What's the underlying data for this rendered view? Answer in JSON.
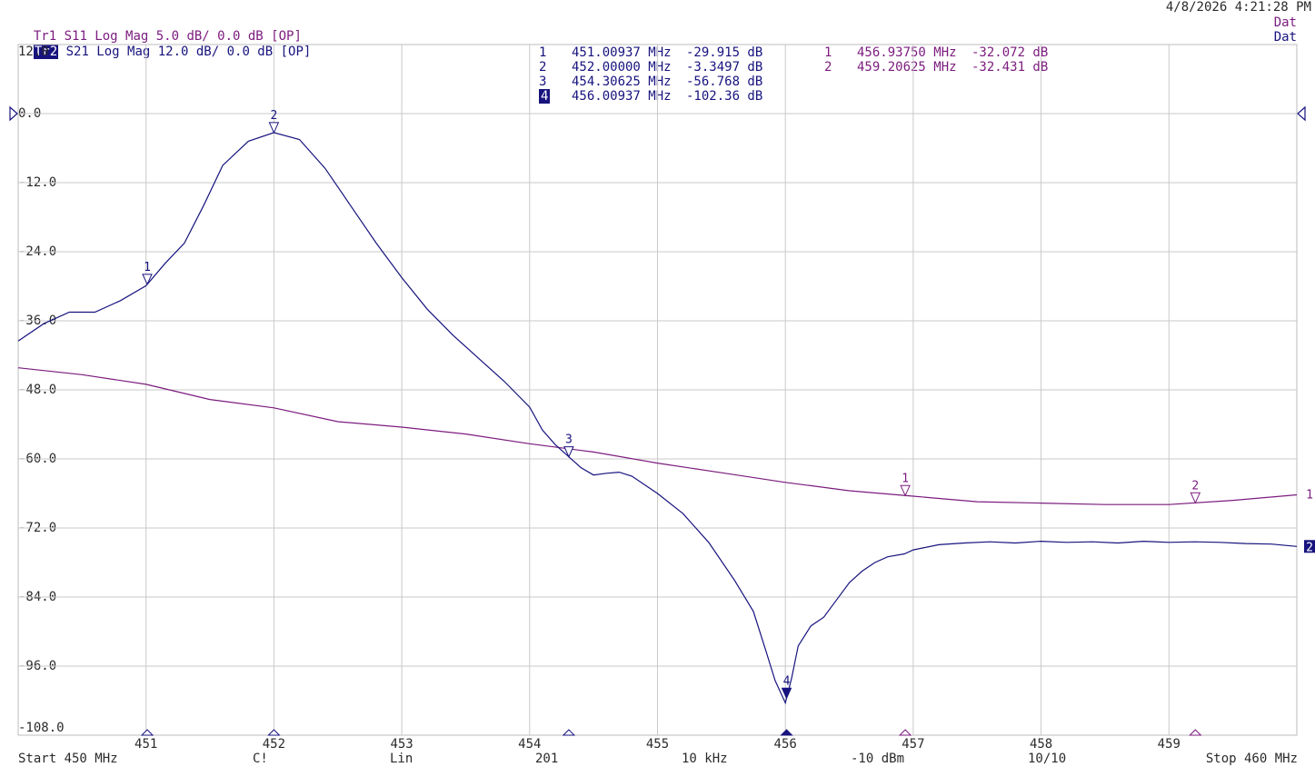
{
  "datetime": "4/8/2026 4:21:28 PM",
  "traces": [
    {
      "id": "Tr1",
      "label": "Tr1",
      "desc": "S11 Log Mag 5.0 dB/ 0.0 dB [OP]",
      "status": "Dat",
      "color": "#7b1b7e"
    },
    {
      "id": "Tr2",
      "label": "Tr2",
      "desc": "S21 Log Mag 12.0 dB/ 0.0 dB [OP]",
      "status": "Dat",
      "color": "#17137e"
    }
  ],
  "markers_tr2": [
    {
      "n": "1",
      "freq": "451.00937 MHz",
      "value": "-29.915 dB",
      "active": false
    },
    {
      "n": "2",
      "freq": "452.00000 MHz",
      "value": "-3.3497 dB",
      "active": false
    },
    {
      "n": "3",
      "freq": "454.30625 MHz",
      "value": "-56.768 dB",
      "active": false
    },
    {
      "n": "4",
      "freq": "456.00937 MHz",
      "value": "-102.36 dB",
      "active": true
    }
  ],
  "markers_tr1": [
    {
      "n": "1",
      "freq": "456.93750 MHz",
      "value": "-32.072 dB"
    },
    {
      "n": "2",
      "freq": "459.20625 MHz",
      "value": "-32.431 dB"
    }
  ],
  "footer": {
    "start": "Start 450 MHz",
    "c": "C!",
    "lin": "Lin",
    "points": "201",
    "ifbw": "10 kHz",
    "power": "-10 dBm",
    "avg": "10/10",
    "stop": "Stop 460 MHz"
  },
  "chart_data": {
    "type": "line",
    "xlabel": "",
    "ylabel": "",
    "xlim": [
      450,
      460
    ],
    "ylim": [
      -108,
      12
    ],
    "y_ticks": [
      "12.0",
      "0.0",
      "-12.0",
      "-24.0",
      "-36.0",
      "-48.0",
      "-60.0",
      "-72.0",
      "-84.0",
      "-96.0",
      "-108.0"
    ],
    "x_ticks": [
      "451",
      "452",
      "453",
      "454",
      "455",
      "456",
      "457",
      "458",
      "459"
    ],
    "reference_level_db": 0.0,
    "grid": true,
    "series": [
      {
        "name": "S21",
        "trace": "Tr2",
        "scale_db_per_div": 12,
        "color": "#17137e",
        "x": [
          450.0,
          450.2,
          450.4,
          450.6,
          450.8,
          451.0,
          451.15,
          451.3,
          451.45,
          451.6,
          451.8,
          452.0,
          452.2,
          452.4,
          452.6,
          452.8,
          453.0,
          453.2,
          453.4,
          453.6,
          453.8,
          454.0,
          454.1,
          454.2,
          454.3,
          454.4,
          454.5,
          454.6,
          454.7,
          454.8,
          455.0,
          455.2,
          455.4,
          455.6,
          455.75,
          455.85,
          455.92,
          456.0,
          456.05,
          456.1,
          456.2,
          456.3,
          456.4,
          456.5,
          456.6,
          456.7,
          456.8,
          456.93,
          457.0,
          457.2,
          457.4,
          457.6,
          457.8,
          458.0,
          458.2,
          458.4,
          458.6,
          458.8,
          459.0,
          459.2,
          459.4,
          459.6,
          459.8,
          460.0
        ],
        "values": [
          -39.5,
          -36.5,
          -34.5,
          -34.5,
          -32.5,
          -29.9,
          -26.0,
          -22.5,
          -16.0,
          -9.0,
          -4.8,
          -3.3,
          -4.5,
          -9.5,
          -16.0,
          -22.5,
          -28.5,
          -34.0,
          -38.5,
          -42.5,
          -46.5,
          -51.0,
          -55.0,
          -57.5,
          -59.5,
          -61.5,
          -62.8,
          -62.5,
          -62.3,
          -63.0,
          -66.0,
          -69.5,
          -74.5,
          -81.0,
          -86.5,
          -93.5,
          -98.5,
          -102.4,
          -98.0,
          -92.5,
          -89.0,
          -87.5,
          -84.5,
          -81.5,
          -79.5,
          -78.0,
          -77.0,
          -76.5,
          -75.8,
          -74.9,
          -74.6,
          -74.4,
          -74.6,
          -74.3,
          -74.5,
          -74.4,
          -74.6,
          -74.3,
          -74.5,
          -74.4,
          -74.5,
          -74.7,
          -74.8,
          -75.2
        ],
        "markers": [
          {
            "n": 1,
            "x": 451.00937,
            "y": -29.915
          },
          {
            "n": 2,
            "x": 452.0,
            "y": -3.3497
          },
          {
            "n": 3,
            "x": 454.30625,
            "y": -56.768
          },
          {
            "n": 4,
            "x": 456.00937,
            "y": -102.36
          }
        ]
      },
      {
        "name": "S11",
        "trace": "Tr1",
        "scale_db_per_div": 5,
        "color": "#7b1b7e",
        "x": [
          450.0,
          450.5,
          451.0,
          451.5,
          452.0,
          452.5,
          453.0,
          453.5,
          454.0,
          454.5,
          455.0,
          455.5,
          456.0,
          456.5,
          457.0,
          457.5,
          458.0,
          458.5,
          459.0,
          459.5,
          460.0
        ],
        "values": [
          -18.4,
          -18.9,
          -19.6,
          -20.7,
          -21.3,
          -22.3,
          -22.7,
          -23.2,
          -23.9,
          -24.5,
          -25.3,
          -26.0,
          -26.7,
          -27.3,
          -27.7,
          -28.1,
          -28.2,
          -28.3,
          -28.3,
          -28.0,
          -27.6
        ],
        "markers": [
          {
            "n": 1,
            "x": 456.9375,
            "y": -32.072
          },
          {
            "n": 2,
            "x": 459.20625,
            "y": -32.431
          }
        ]
      }
    ]
  }
}
